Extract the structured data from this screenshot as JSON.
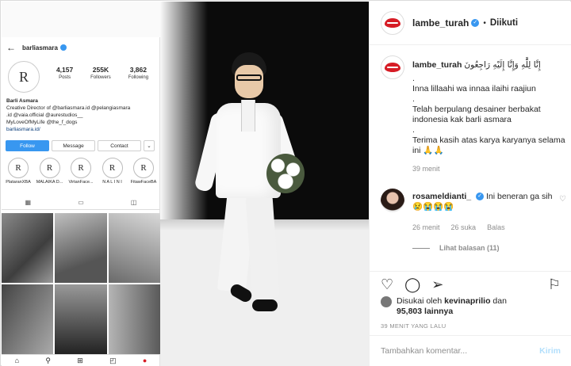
{
  "inner": {
    "username": "barliasmara",
    "avatar_monogram": "R",
    "stats": [
      {
        "value": "4,157",
        "label": "Posts"
      },
      {
        "value": "255K",
        "label": "Followers"
      },
      {
        "value": "3,862",
        "label": "Following"
      }
    ],
    "bio_name": "Barli Asmara",
    "bio_line1": "Creative Director of @barliasmara.id @pelangiasmara",
    "bio_line2": ".id @vaia.official @aurestudios__",
    "bio_line3": "MyLoveOfMyLife @the_f_dogs",
    "bio_link": "barliasmara.id/",
    "buttons": {
      "follow": "Follow",
      "message": "Message",
      "contact": "Contact",
      "more": "⌄"
    },
    "highlights": [
      "PlataranXBA",
      "MALAIKA D...",
      "VirtanFace...",
      "N A L I N I",
      "FitawFaceBA"
    ]
  },
  "panel": {
    "username": "lambe_turah",
    "follow_status": "Diikuti",
    "caption_arabic": "إِنَّا لِلَّٰهِ وَإِنَّا إِلَيْهِ رَاجِعُونَ",
    "caption_lines": [
      ".",
      "Inna lillaahi wa innaa ilaihi raajiun",
      ".",
      "Telah berpulang desainer berbakat indonesia kak barli asmara",
      ".",
      "Terima kasih atas karya karyanya selama ini 🙏🙏"
    ],
    "caption_time": "39 menit",
    "comment": {
      "username": "rosameldianti_",
      "text": "Ini beneran ga sih 😢😭😭😭",
      "time": "26 menit",
      "likes": "26 suka",
      "reply": "Balas",
      "view_replies": "Lihat balasan (11)"
    },
    "liked_by_prefix": "Disukai oleh",
    "liked_by_user": "kevinaprilio",
    "liked_by_and": "dan",
    "liked_by_count": "95,803 lainnya",
    "posted_ago": "39 MENIT YANG LALU",
    "comment_placeholder": "Tambahkan komentar...",
    "send_label": "Kirim"
  }
}
